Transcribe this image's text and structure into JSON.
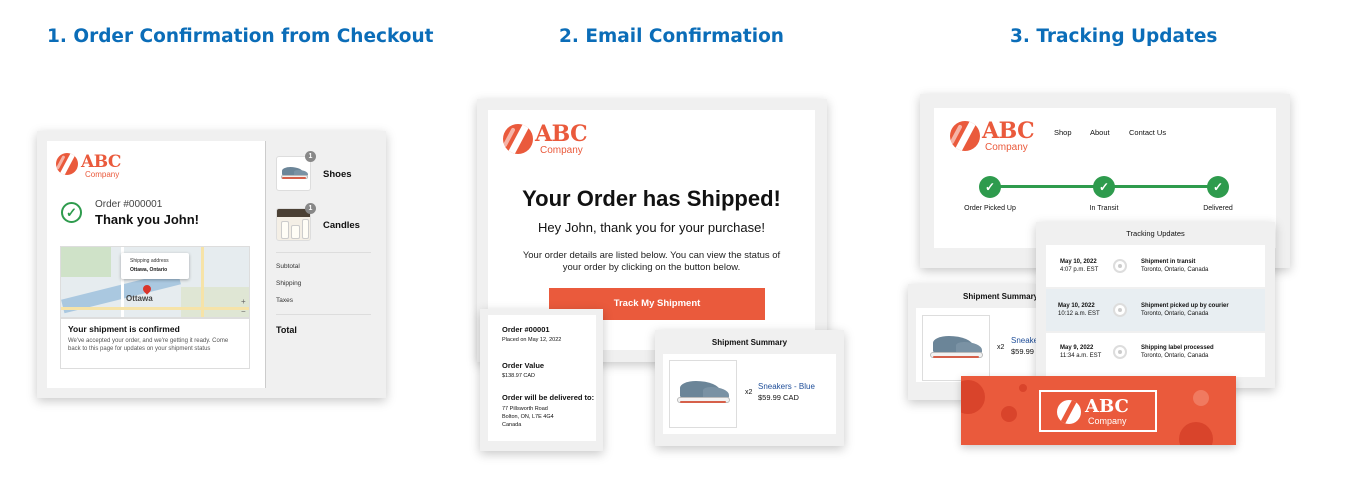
{
  "headings": {
    "step1": "1. Order Confirmation from Checkout",
    "step2": "2. Email Confirmation",
    "step3": "3. Tracking Updates"
  },
  "brand": {
    "name": "ABC",
    "sub": "Company",
    "color": "#ea5a3c"
  },
  "colors": {
    "heading": "#0b6db8",
    "accent": "#ea5a3c",
    "success": "#2e9b4d",
    "link": "#1f4e99"
  },
  "checkout": {
    "order_number": "Order #000001",
    "thank_you": "Thank you John!",
    "map": {
      "label": "Shipping address",
      "value": "Ottawa, Ontario",
      "city": "Ottawa"
    },
    "confirmed_title": "Your shipment is confirmed",
    "confirmed_body": "We've accepted your order, and we're getting it ready. Come back to this page for updates on your shipment status",
    "items": [
      {
        "name": "Shoes",
        "qty": "1",
        "icon": "shoe-thumbnail"
      },
      {
        "name": "Candles",
        "qty": "1",
        "icon": "candles-thumbnail"
      }
    ],
    "subtotal": "Subtotal",
    "shipping": "Shipping",
    "taxes": "Taxes",
    "total": "Total"
  },
  "email": {
    "title": "Your Order has Shipped!",
    "greeting": "Hey John, thank you for your purchase!",
    "body": "Your order details are listed below. You can view the status of your order by clicking on the button below.",
    "button": "Track My Shipment",
    "order": {
      "number": "Order #00001",
      "placed": "Placed on May 12, 2022",
      "value_label": "Order Value",
      "value": "$138.97 CAD",
      "deliver_label": "Order will be delivered to:",
      "address1": "77 Pillsworth Road",
      "address2": "Bolton, ON, L7E 4G4",
      "address3": "Canada"
    },
    "summary": {
      "title": "Shipment Summary",
      "qty": "x2",
      "product": "Sneakers",
      "sep": " - ",
      "variant": "Blue",
      "price": "$59.99 CAD"
    }
  },
  "tracking": {
    "nav": [
      "Shop",
      "About",
      "Contact Us"
    ],
    "steps": [
      "Order Picked Up",
      "In Transit",
      "Delivered"
    ],
    "updates_title": "Tracking Updates",
    "updates": [
      {
        "date": "May 10, 2022",
        "time": "4:07 p.m. EST",
        "status": "Shipment in transit",
        "location": "Toronto, Ontario, Canada"
      },
      {
        "date": "May 10, 2022",
        "time": "10:12 a.m. EST",
        "status": "Shipment picked up by courier",
        "location": "Toronto, Ontario, Canada"
      },
      {
        "date": "May 9, 2022",
        "time": "11:34 a.m. EST",
        "status": "Shipping label processed",
        "location": "Toronto, Ontario, Canada"
      }
    ],
    "summary": {
      "title": "Shipment Summary",
      "qty": "x2",
      "product": "Sneake",
      "price": "$59.99"
    }
  }
}
